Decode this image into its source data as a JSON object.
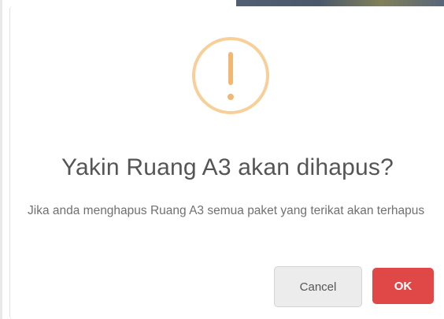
{
  "dialog": {
    "icon": "exclamation-circle-icon",
    "icon_color": "#f8cf99",
    "icon_mark_color": "#f3b774",
    "title": "Yakin Ruang A3 akan dihapus?",
    "message": "Jika anda menghapus Ruang A3 semua paket yang terikat akan terhapus",
    "buttons": {
      "cancel_label": "Cancel",
      "ok_label": "OK"
    },
    "colors": {
      "ok_button": "#e04848",
      "cancel_button": "#ececec"
    }
  }
}
